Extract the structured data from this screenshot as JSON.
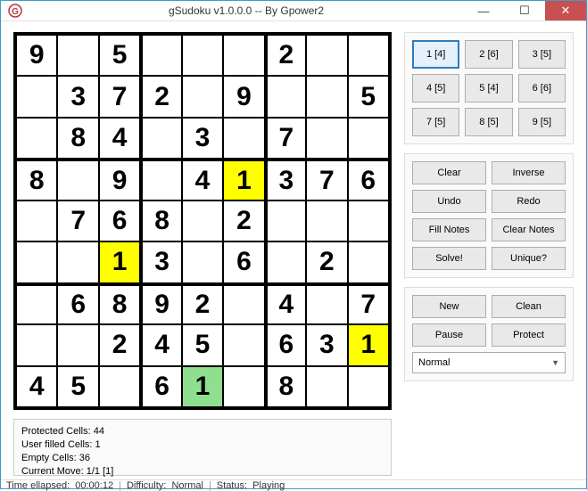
{
  "window": {
    "title": "gSudoku v1.0.0.0 -- By Gpower2"
  },
  "grid": [
    [
      "9",
      "",
      "5",
      "",
      "",
      "",
      "2",
      "",
      ""
    ],
    [
      "",
      "3",
      "7",
      "2",
      "",
      "9",
      "",
      "",
      "5"
    ],
    [
      "",
      "8",
      "4",
      "",
      "3",
      "",
      "7",
      "",
      ""
    ],
    [
      "8",
      "",
      "9",
      "",
      "4",
      "1",
      "3",
      "7",
      "6"
    ],
    [
      "",
      "7",
      "6",
      "8",
      "",
      "2",
      "",
      "",
      ""
    ],
    [
      "",
      "",
      "1",
      "3",
      "",
      "6",
      "",
      "2",
      ""
    ],
    [
      "",
      "6",
      "8",
      "9",
      "2",
      "",
      "4",
      "",
      "7"
    ],
    [
      "",
      "",
      "2",
      "4",
      "5",
      "",
      "6",
      "3",
      "1"
    ],
    [
      "4",
      "5",
      "",
      "6",
      "1",
      "",
      "8",
      "",
      ""
    ]
  ],
  "highlights": {
    "yellow": [
      [
        3,
        5
      ],
      [
        5,
        2
      ],
      [
        7,
        8
      ]
    ],
    "green": [
      [
        8,
        4
      ]
    ]
  },
  "info": {
    "line1": "Protected Cells: 44",
    "line2": "User filled Cells: 1",
    "line3": "Empty Cells: 36",
    "line4": "Current Move: 1/1 [1]"
  },
  "numpad": [
    {
      "label": "1 [4]",
      "active": true
    },
    {
      "label": "2 [6]",
      "active": false
    },
    {
      "label": "3 [5]",
      "active": false
    },
    {
      "label": "4 [5]",
      "active": false
    },
    {
      "label": "5 [4]",
      "active": false
    },
    {
      "label": "6 [6]",
      "active": false
    },
    {
      "label": "7 [5]",
      "active": false
    },
    {
      "label": "8 [5]",
      "active": false
    },
    {
      "label": "9 [5]",
      "active": false
    }
  ],
  "actions1": {
    "clear": "Clear",
    "inverse": "Inverse",
    "undo": "Undo",
    "redo": "Redo",
    "fillnotes": "Fill Notes",
    "clearnotes": "Clear Notes",
    "solve": "Solve!",
    "unique": "Unique?"
  },
  "actions2": {
    "new": "New",
    "clean": "Clean",
    "pause": "Pause",
    "protect": "Protect",
    "difficulty_selected": "Normal"
  },
  "status": {
    "time_label": "Time ellapsed:",
    "time_value": "00:00:12",
    "diff_label": "Difficulty:",
    "diff_value": "Normal",
    "status_label": "Status:",
    "status_value": "Playing"
  }
}
